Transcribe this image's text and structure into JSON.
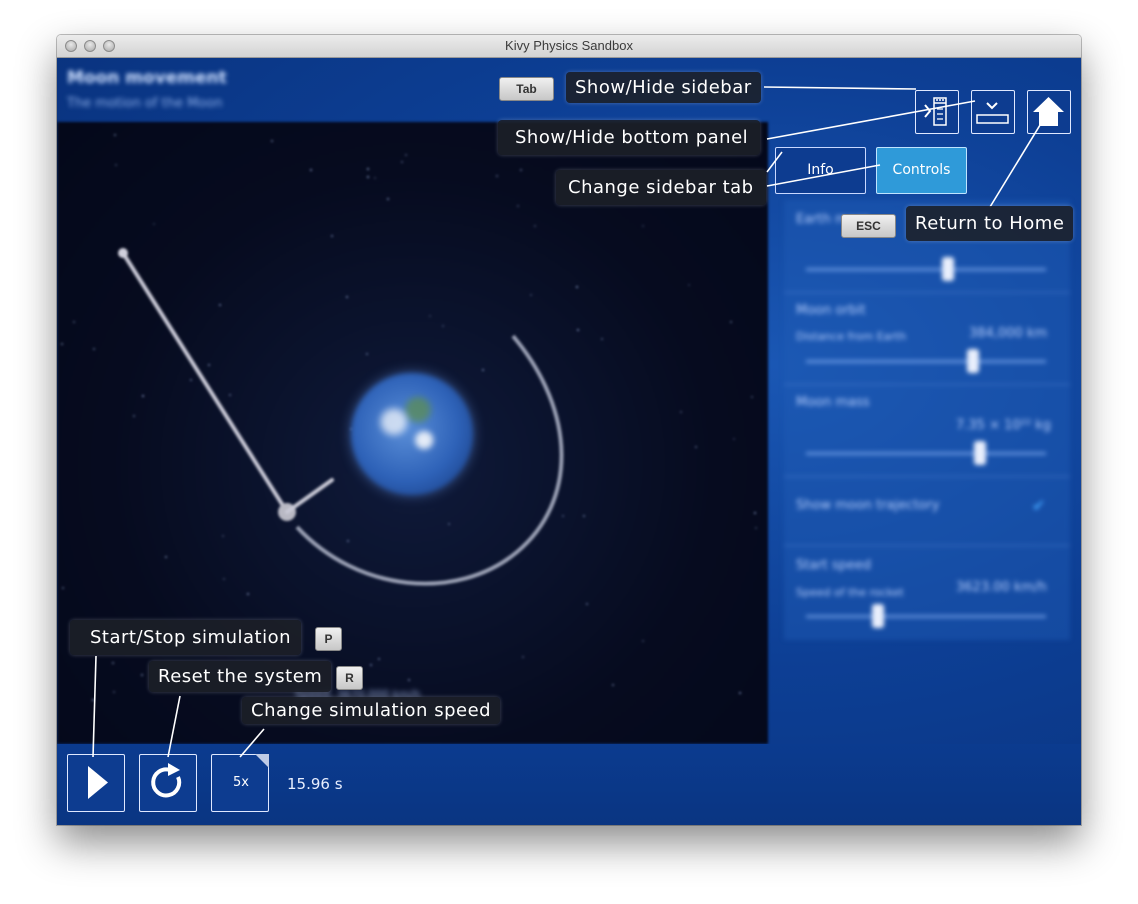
{
  "window": {
    "title": "Kivy Physics Sandbox"
  },
  "header": {
    "title": "Moon movement",
    "subtitle": "The motion of the Moon"
  },
  "top_controls": {
    "sidebar_toggle_icon": "sidebar-toggle-icon",
    "bottom_panel_toggle_icon": "bottom-panel-toggle-icon",
    "home_icon": "home-icon"
  },
  "sidebar": {
    "tabs": [
      {
        "label": "Info"
      },
      {
        "label": "Controls"
      }
    ],
    "active_tab": "Controls",
    "rows": [
      {
        "label": "Earth mass"
      },
      {
        "label": "Moon orbit",
        "sublabel": "Distance from Earth",
        "value": "384,000 km"
      },
      {
        "label": "Moon mass",
        "value": "7.35 × 10²² kg"
      },
      {
        "label": "Show moon trajectory",
        "checked": true
      },
      {
        "label": "Start speed",
        "sublabel": "Speed of the rocket",
        "value": "3623.00 km/h"
      }
    ]
  },
  "simulation": {
    "info_text": "Speed: 3670.000 km/h"
  },
  "bottom_bar": {
    "play_icon": "play-icon",
    "reset_icon": "reset-icon",
    "speed": "5x",
    "time": "15.96 s"
  },
  "tooltips": {
    "sidebar": {
      "key": "Tab",
      "text": "Show/Hide sidebar"
    },
    "bottom_panel": {
      "text": "Show/Hide bottom panel"
    },
    "sidebar_tab": {
      "text": "Change sidebar tab"
    },
    "home": {
      "key": "ESC",
      "text": "Return to Home"
    },
    "start_stop": {
      "key": "P",
      "text": "Start/Stop simulation"
    },
    "reset": {
      "key": "R",
      "text": "Reset the system"
    },
    "speed": {
      "text": "Change simulation speed"
    }
  },
  "colors": {
    "app_background": "#0d3f95",
    "tab_active": "#2f9ad9",
    "tooltip_background": "#1c2028",
    "button_border": "#dfe8ff"
  }
}
